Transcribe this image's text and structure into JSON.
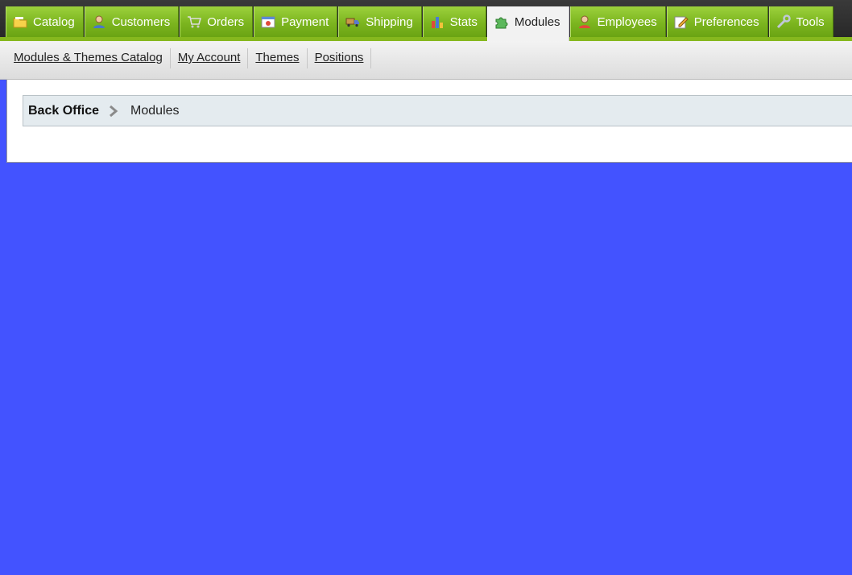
{
  "tabs": [
    {
      "label": "Catalog",
      "icon": "folder-icon",
      "active": false
    },
    {
      "label": "Customers",
      "icon": "customer-icon",
      "active": false
    },
    {
      "label": "Orders",
      "icon": "cart-icon",
      "active": false
    },
    {
      "label": "Payment",
      "icon": "payment-icon",
      "active": false
    },
    {
      "label": "Shipping",
      "icon": "truck-icon",
      "active": false
    },
    {
      "label": "Stats",
      "icon": "bar-chart-icon",
      "active": false
    },
    {
      "label": "Modules",
      "icon": "puzzle-icon",
      "active": true
    },
    {
      "label": "Employees",
      "icon": "employee-icon",
      "active": false
    },
    {
      "label": "Preferences",
      "icon": "pencil-note-icon",
      "active": false
    },
    {
      "label": "Tools",
      "icon": "wrench-icon",
      "active": false
    }
  ],
  "subtabs": [
    "Modules & Themes Catalog",
    "My Account",
    "Themes",
    "Positions"
  ],
  "breadcrumb": {
    "root": "Back Office",
    "current": "Modules"
  },
  "colors": {
    "accent": "#86b81e",
    "background": "#4353ff",
    "breadcrumb_bg": "#e4ebef"
  }
}
